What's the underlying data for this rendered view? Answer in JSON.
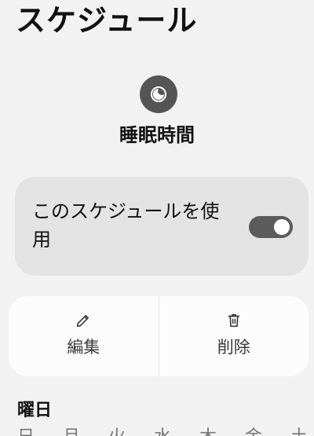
{
  "header": {
    "title": "スケジュール"
  },
  "mode": {
    "icon": "sleep-moon-icon",
    "name": "睡眠時間"
  },
  "schedule_toggle": {
    "label": "このスケジュールを使用",
    "enabled": true
  },
  "actions": {
    "edit_label": "編集",
    "edit_icon": "pencil-icon",
    "delete_label": "削除",
    "delete_icon": "trash-icon"
  },
  "days_section": {
    "title": "曜日",
    "days": [
      "日",
      "月",
      "火",
      "水",
      "木",
      "金",
      "土"
    ]
  }
}
